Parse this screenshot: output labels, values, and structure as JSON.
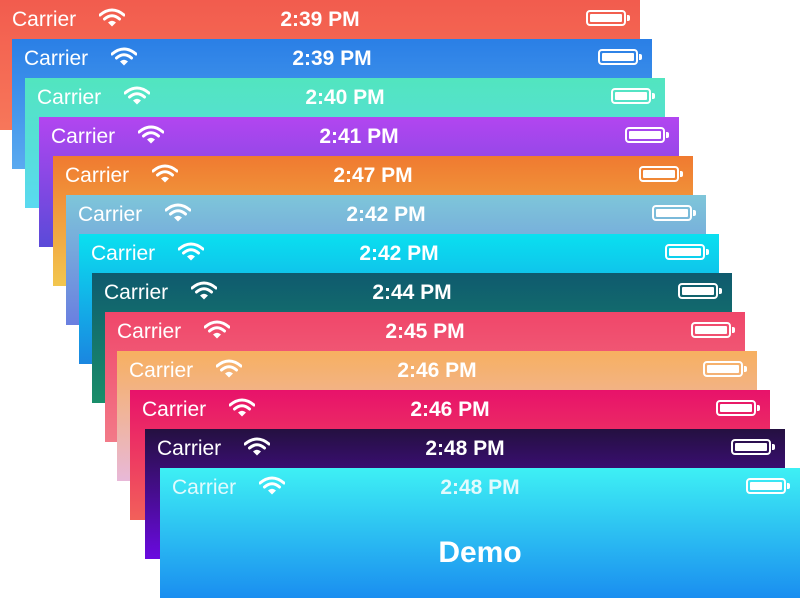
{
  "cards": [
    {
      "carrier": "Carrier",
      "time": "2:39 PM",
      "battery_level": 1.0,
      "colors": [
        "#f25c4e",
        "#f7775a"
      ]
    },
    {
      "carrier": "Carrier",
      "time": "2:39 PM",
      "battery_level": 1.0,
      "colors": [
        "#2a7fe6",
        "#5aaaf0"
      ]
    },
    {
      "carrier": "Carrier",
      "time": "2:40 PM",
      "battery_level": 1.0,
      "colors": [
        "#52e5bf",
        "#5ad9f0"
      ]
    },
    {
      "carrier": "Carrier",
      "time": "2:41 PM",
      "battery_level": 1.0,
      "colors": [
        "#b246f0",
        "#5a4ad8"
      ]
    },
    {
      "carrier": "Carrier",
      "time": "2:47 PM",
      "battery_level": 1.0,
      "colors": [
        "#f07a30",
        "#f2c64e"
      ]
    },
    {
      "carrier": "Carrier",
      "time": "2:42 PM",
      "battery_level": 1.0,
      "colors": [
        "#7ec6d9",
        "#6a7fe0"
      ]
    },
    {
      "carrier": "Carrier",
      "time": "2:42 PM",
      "battery_level": 1.0,
      "colors": [
        "#0ae0f0",
        "#1a86e0"
      ]
    },
    {
      "carrier": "Carrier",
      "time": "2:44 PM",
      "battery_level": 1.0,
      "colors": [
        "#0f5a6e",
        "#1a8e6a"
      ]
    },
    {
      "carrier": "Carrier",
      "time": "2:45 PM",
      "battery_level": 1.0,
      "colors": [
        "#f0466a",
        "#f27a88"
      ]
    },
    {
      "carrier": "Carrier",
      "time": "2:46 PM",
      "battery_level": 1.0,
      "colors": [
        "#f7b060",
        "#e8b8d8"
      ]
    },
    {
      "carrier": "Carrier",
      "time": "2:46 PM",
      "battery_level": 1.0,
      "colors": [
        "#e8126a",
        "#f2605a"
      ]
    },
    {
      "carrier": "Carrier",
      "time": "2:48 PM",
      "battery_level": 1.0,
      "colors": [
        "#241040",
        "#6a0ae0"
      ]
    },
    {
      "carrier": "Carrier",
      "time": "2:48 PM",
      "battery_level": 1.0,
      "colors": [
        "#3ef0f4",
        "#1a8ef0"
      ],
      "title": "Demo"
    }
  ]
}
